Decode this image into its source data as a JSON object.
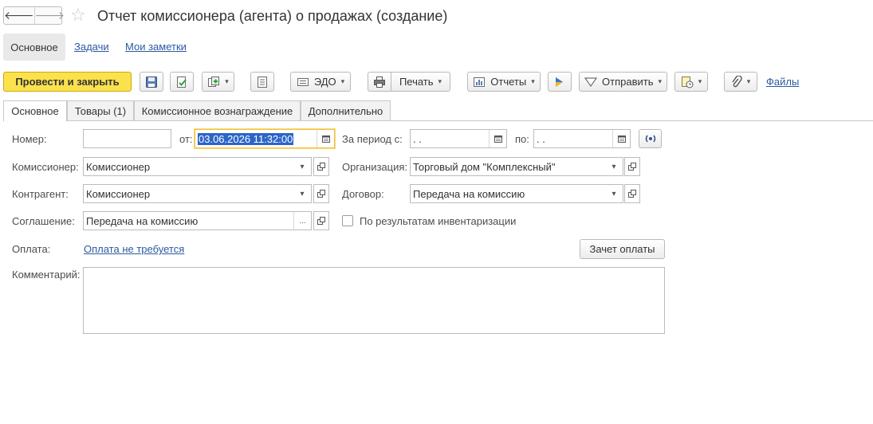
{
  "window": {
    "title": "Отчет комиссионера (агента) о продажах (создание)",
    "back_glyph": "🡐",
    "forward_glyph": "🡒",
    "star_glyph": "☆"
  },
  "sections": {
    "active": "Основное",
    "links": [
      "Задачи",
      "Мои заметки"
    ]
  },
  "toolbar": {
    "post_and_close": "Провести и закрыть",
    "edo": "ЭДО",
    "print": "Печать",
    "reports": "Отчеты",
    "send": "Отправить",
    "files": "Файлы",
    "caret": "▾",
    "primary_color": "#fbe14c"
  },
  "tabs": [
    "Основное",
    "Товары (1)",
    "Комиссионное вознаграждение",
    "Дополнительно"
  ],
  "form": {
    "number_label": "Номер:",
    "number_value": "",
    "date_from_label": "от:",
    "date_value": "03.06.2026 11:32:00",
    "period_from_label": "За период с:",
    "period_from_value": " .  .",
    "period_to_label": "по:",
    "period_to_value": " .  .",
    "commissioner_label": "Комиссионер:",
    "commissioner_value": "Комиссионер",
    "organization_label": "Организация:",
    "organization_value": "Торговый дом \"Комплексный\"",
    "counterparty_label": "Контрагент:",
    "counterparty_value": "Комиссионер",
    "contract_label": "Договор:",
    "contract_value": "Передача на комиссию",
    "agreement_label": "Соглашение:",
    "agreement_value": "Передача на комиссию",
    "inventory_checkbox_label": "По результатам инвентаризации",
    "payment_label": "Оплата:",
    "payment_link": "Оплата не требуется",
    "payment_offset_button": "Зачет оплаты",
    "comment_label": "Комментарий:",
    "comment_value": "",
    "ellipsis": "...",
    "dropdown_glyph": "▾"
  }
}
